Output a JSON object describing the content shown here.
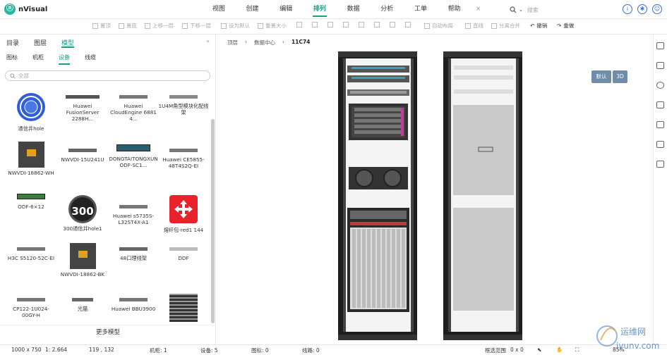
{
  "app": {
    "name": "nVisual"
  },
  "menu": [
    "视图",
    "创建",
    "编辑",
    "排列",
    "数据",
    "分析",
    "工单",
    "帮助"
  ],
  "menu_active": "排列",
  "search": {
    "placeholder": "搜索"
  },
  "toolbar": [
    "置顶",
    "置底",
    "上移一层",
    "下移一层",
    "设为默认",
    "重置大小",
    "自动布局",
    "直线",
    "分离合并",
    "撤销",
    "重做"
  ],
  "sidebar": {
    "tabs": [
      "目录",
      "图层",
      "模型"
    ],
    "active_tab": "模型",
    "subtabs": [
      "图标",
      "机柜",
      "设备",
      "线缆"
    ],
    "active_subtab": "设备",
    "search_placeholder": "全部",
    "items": [
      "通信井hole",
      "Huawei FusionServer 2288H...",
      "Huawei CloudEngine 6881 4...",
      "1U4M角型模块化配线架",
      "NWVDI-18862-WH",
      "NWVDI-15U241U",
      "DONGTAITONGXUN ODF-SC1...",
      "Huawei CE5855-48T4S2Q-EI",
      "ODF-6×12",
      "300通信井hole1",
      "Huawei s5735S-L32ST4X-A1",
      "熔纤包-red1 144",
      "H3C S5120-52C-EI",
      "NWVDI-18862-BK",
      "48口理线架",
      "DDF",
      "CP122-1U024-00GY-H",
      "光猫",
      "Huawei BBU3900",
      ""
    ],
    "icon_300": "300",
    "more_label": "更多模型"
  },
  "breadcrumb": [
    "顶层",
    "数据中心",
    "11C74"
  ],
  "view_buttons": {
    "default": "默认",
    "three_d": "3D"
  },
  "status": {
    "canvas_size": "1000 x 750",
    "scale": "1: 2.664",
    "cursor": "119 , 132",
    "cabinets": "机柜: 1",
    "devices": "设备: 5",
    "icons": "图标: 0",
    "lines": "线路: 0",
    "selection": "框选范围",
    "selection_value": "0 x 0",
    "zoom": "85%"
  },
  "watermark": {
    "cn": "运维网",
    "url": "iyunv.com"
  },
  "colors": {
    "accent": "#16a085",
    "rack": "#1e1e1e",
    "panel_gray": "#c9c9c9",
    "button": "#6f8da8"
  }
}
